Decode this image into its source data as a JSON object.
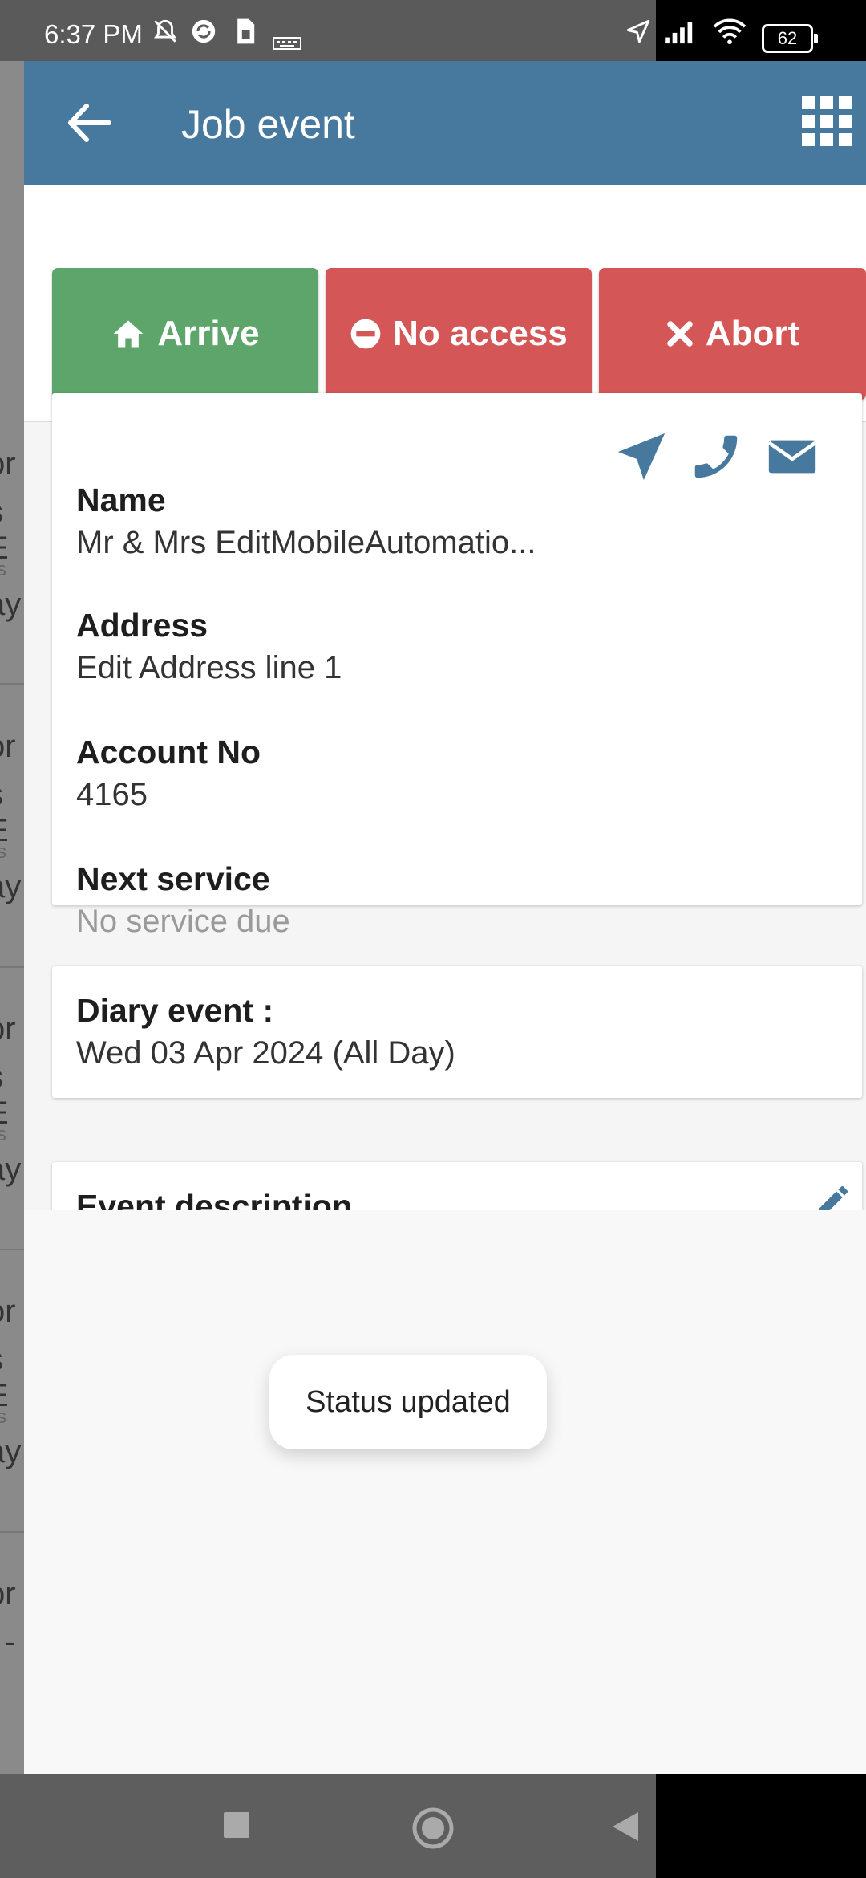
{
  "status_bar": {
    "time": "6:37 PM",
    "battery": "62"
  },
  "background_list": {
    "fragments": [
      "or",
      "s E",
      "ss",
      "ay",
      "or",
      "s E",
      "ss",
      "ay",
      "or",
      "s E",
      "ss",
      "ay",
      "or",
      "s E",
      "ss",
      "ay",
      "or",
      "-"
    ]
  },
  "header": {
    "title": "Job event"
  },
  "actions": {
    "arrive_label": "Arrive",
    "no_access_label": "No access",
    "abort_label": "Abort"
  },
  "customer": {
    "name_label": "Name",
    "name_value": "Mr & Mrs EditMobileAutomatio...",
    "address_label": "Address",
    "address_value": "Edit Address line 1",
    "account_label": "Account No",
    "account_value": "4165",
    "next_service_label": "Next service",
    "next_service_value": "No service due"
  },
  "diary": {
    "label": "Diary event :",
    "value": "Wed 03 Apr 2024 (All Day)"
  },
  "description": {
    "label": "Event description"
  },
  "toast": {
    "message": "Status updated"
  },
  "colors": {
    "header": "#47799e",
    "arrive": "#5da56a",
    "danger": "#d45656",
    "icon_blue": "#47799e"
  },
  "icons": {
    "back": "arrow-left-icon",
    "menu": "grid-icon",
    "arrive": "home-icon",
    "no_access": "no-entry-icon",
    "abort": "close-icon",
    "navigate": "navigation-arrow-icon",
    "phone": "phone-icon",
    "email": "envelope-icon",
    "edit": "pencil-icon"
  }
}
